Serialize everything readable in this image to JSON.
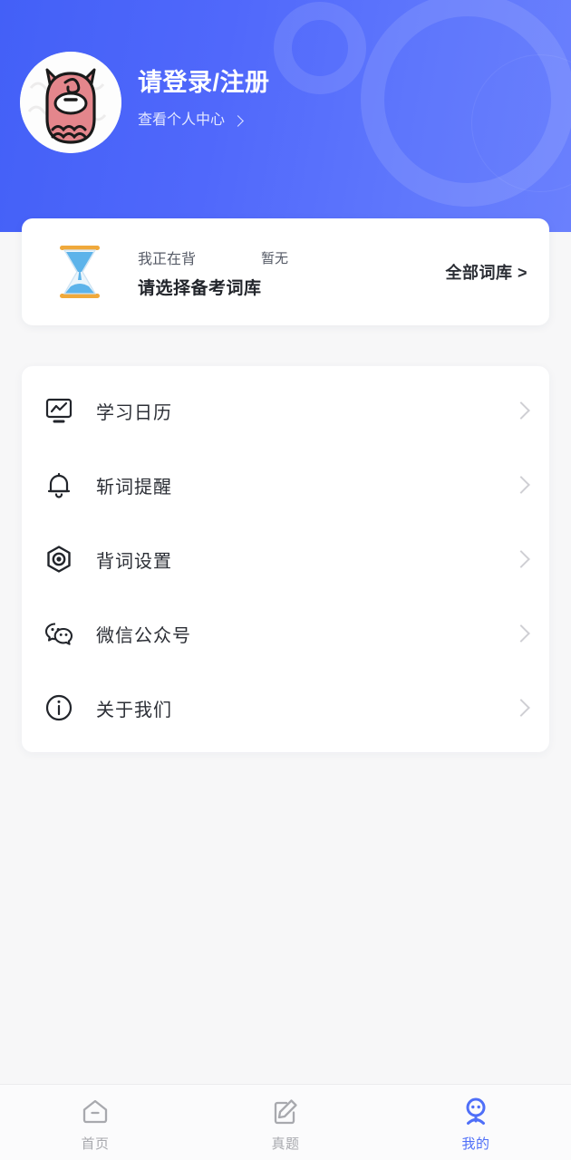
{
  "theme": {
    "brand_blue": "#4f6ff8",
    "header_gradient_start": "#4360f7",
    "header_gradient_end": "#6a80fd",
    "page_background": "#f7f7f8",
    "card_background": "#ffffff",
    "primary_text": "#2c2f36",
    "secondary_text": "#555a66",
    "chevron_gray": "#cfcfd4",
    "hourglass_cap": "#f0a93b",
    "hourglass_sand": "#4ea8e8"
  },
  "header": {
    "avatar_icon": "alpaca-avatar",
    "title": "请登录/注册",
    "profile_link_label": "查看个人中心",
    "profile_link_icon": "chevron-right-icon",
    "decorations": [
      "ring-small",
      "ring-large",
      "ring-faint"
    ]
  },
  "wordbook_card": {
    "icon": "hourglass-icon",
    "status_label": "我正在背",
    "status_value": "暂无",
    "selection_prompt": "请选择备考词库",
    "all_libraries_label": "全部词库 >"
  },
  "menu": {
    "items": [
      {
        "label": "学习日历",
        "icon": "chart-monitor-icon",
        "chevron": "chevron-right-icon"
      },
      {
        "label": "斩词提醒",
        "icon": "bell-icon",
        "chevron": "chevron-right-icon"
      },
      {
        "label": "背词设置",
        "icon": "hex-nut-settings-icon",
        "chevron": "chevron-right-icon"
      },
      {
        "label": "微信公众号",
        "icon": "wechat-icon",
        "chevron": "chevron-right-icon"
      },
      {
        "label": "关于我们",
        "icon": "info-circle-icon",
        "chevron": "chevron-right-icon"
      }
    ]
  },
  "tabbar": {
    "tabs": [
      {
        "label": "首页",
        "icon": "home-icon",
        "active": false
      },
      {
        "label": "真题",
        "icon": "edit-paper-icon",
        "active": false
      },
      {
        "label": "我的",
        "icon": "person-profile-icon",
        "active": true
      }
    ]
  }
}
